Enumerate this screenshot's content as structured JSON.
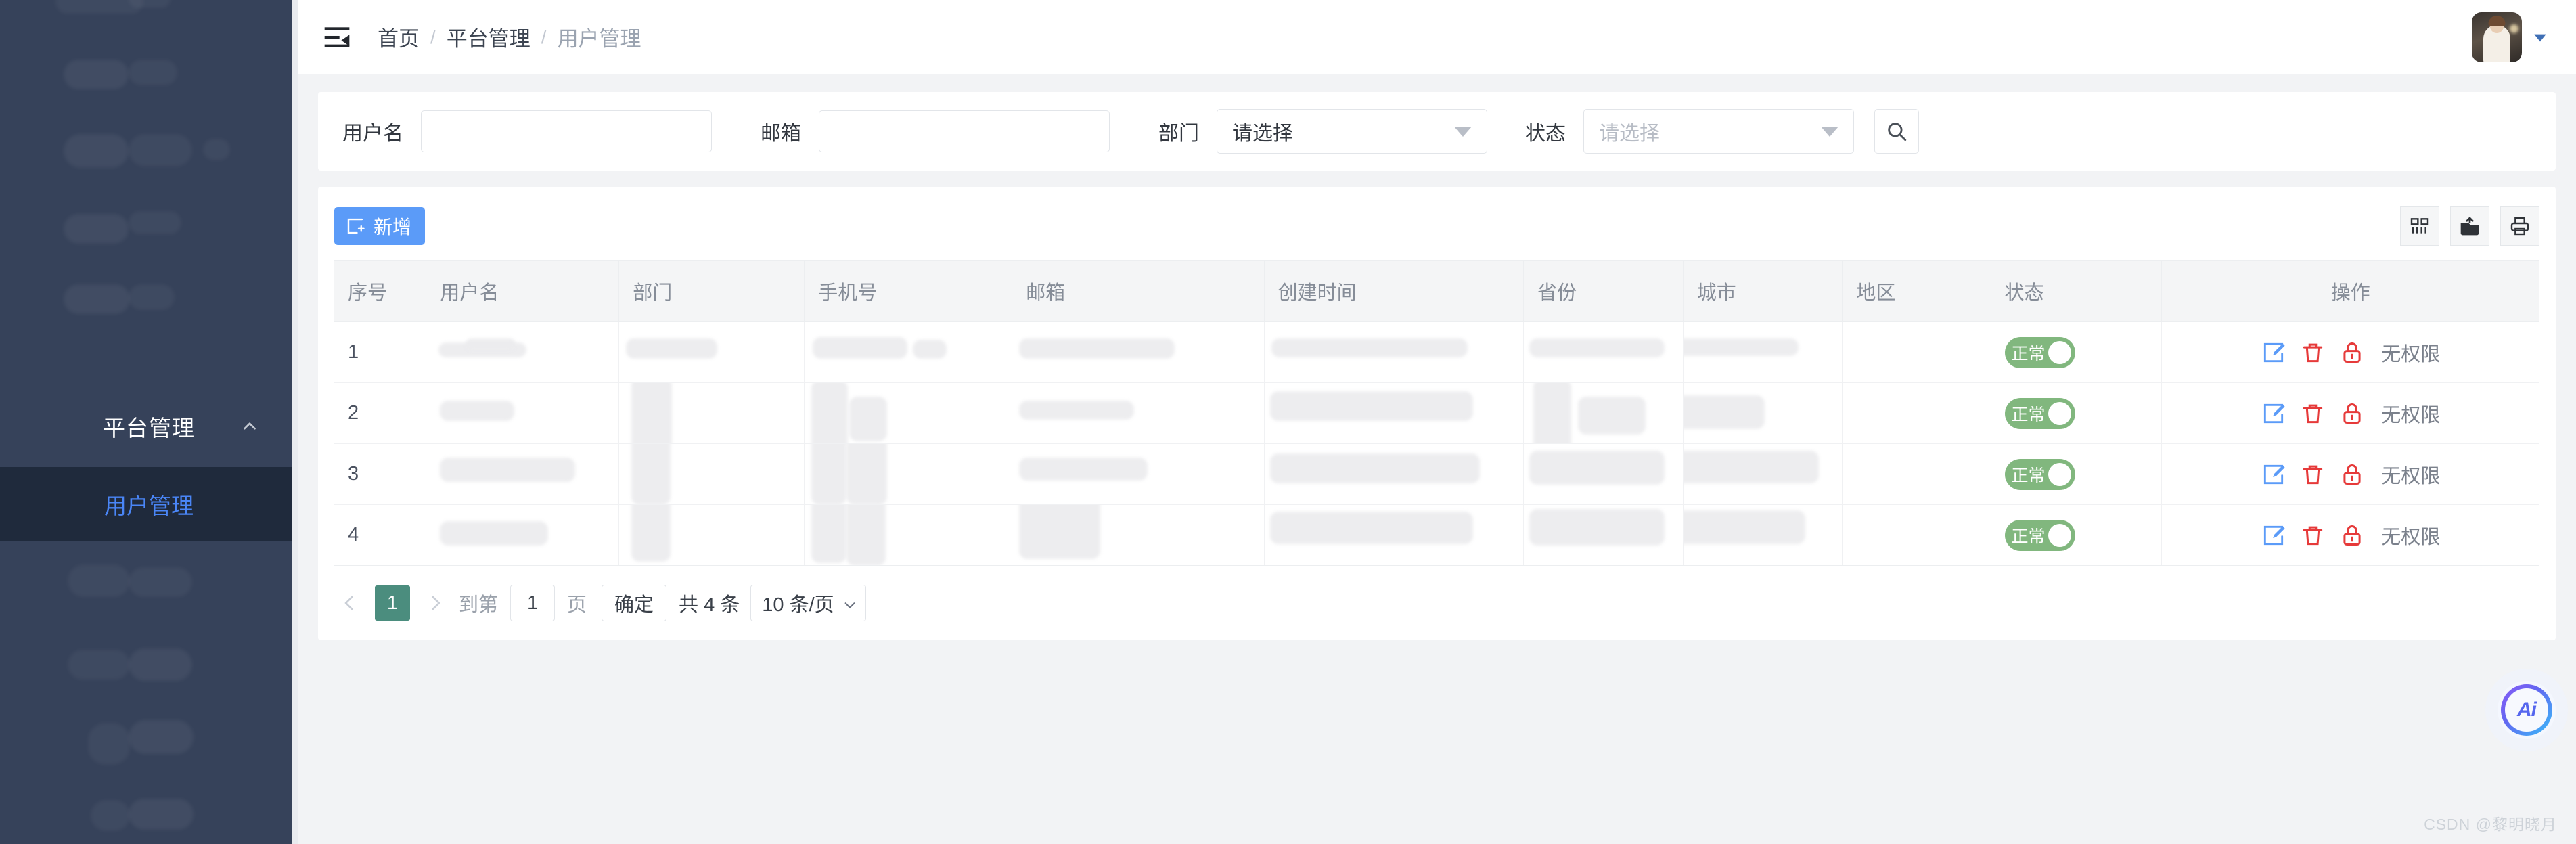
{
  "sidebar": {
    "group_label": "平台管理",
    "collapse_icon": "chevron-up-icon",
    "active_item": "用户管理"
  },
  "header": {
    "fold_icon": "menu-fold-icon",
    "breadcrumb": [
      {
        "label": "首页",
        "active": false
      },
      {
        "label": "平台管理",
        "active": false
      },
      {
        "label": "用户管理",
        "active": true
      }
    ],
    "separator": "/",
    "avatar_icon": "user-avatar",
    "caret_icon": "caret-down-icon"
  },
  "filters": {
    "username": {
      "label": "用户名",
      "value": "",
      "placeholder": ""
    },
    "email": {
      "label": "邮箱",
      "value": "",
      "placeholder": ""
    },
    "department": {
      "label": "部门",
      "value": "请选择",
      "is_placeholder": false
    },
    "status": {
      "label": "状态",
      "value": "请选择",
      "is_placeholder": true
    },
    "search_icon": "search-icon"
  },
  "toolbar": {
    "add_label": "新增",
    "add_icon": "plus-square-icon",
    "icons": [
      {
        "name": "column-settings-icon"
      },
      {
        "name": "export-icon"
      },
      {
        "name": "print-icon"
      }
    ]
  },
  "table": {
    "columns": [
      "序号",
      "用户名",
      "部门",
      "手机号",
      "邮箱",
      "创建时间",
      "省份",
      "城市",
      "地区",
      "状态",
      "操作"
    ],
    "rows": [
      {
        "index": "1",
        "status_label": "正常",
        "status_on": true,
        "action_text": "无权限"
      },
      {
        "index": "2",
        "status_label": "正常",
        "status_on": true,
        "action_text": "无权限"
      },
      {
        "index": "3",
        "status_label": "正常",
        "status_on": true,
        "action_text": "无权限"
      },
      {
        "index": "4",
        "status_label": "正常",
        "status_on": true,
        "action_text": "无权限"
      }
    ],
    "action_icons": [
      {
        "name": "edit-icon",
        "color": "#5b9bf8"
      },
      {
        "name": "delete-icon",
        "color": "#e63a3a"
      },
      {
        "name": "lock-icon",
        "color": "#e63a3a"
      }
    ]
  },
  "pagination": {
    "prev_icon": "chevron-left-icon",
    "next_icon": "chevron-right-icon",
    "current_page": "1",
    "goto_prefix": "到第",
    "goto_value": "1",
    "goto_suffix": "页",
    "confirm_label": "确定",
    "total_label": "共 4 条",
    "page_size": "10 条/页",
    "page_size_icon": "chevron-down-icon"
  },
  "fab": {
    "label": "Ai"
  },
  "watermark": {
    "text": "CSDN @黎明晓月"
  },
  "colors": {
    "sidebar_bg": "#36425a",
    "sidebar_sub_bg": "#1f2a3c",
    "sidebar_active_text": "#4a86f7",
    "primary_blue": "#5b9bf8",
    "danger_red": "#e63a3a",
    "switch_green": "#81b77e",
    "pager_active": "#4b8d7e"
  }
}
